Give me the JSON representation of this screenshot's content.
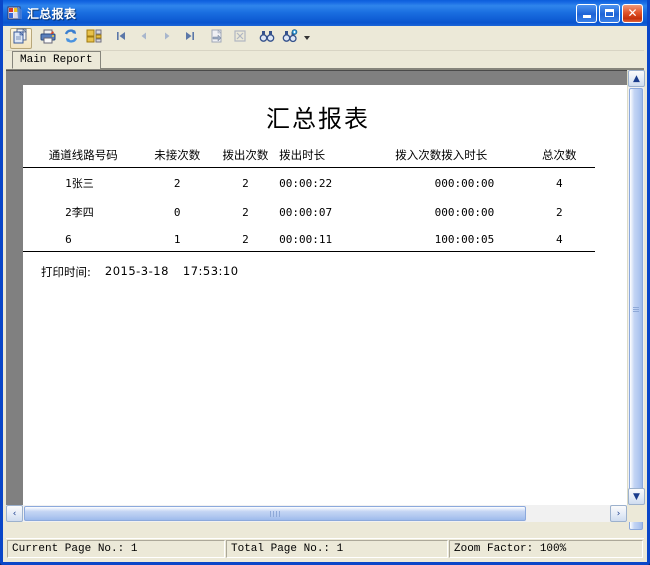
{
  "window": {
    "title": "汇总报表",
    "icon": "report-window-icon",
    "controls": {
      "minimize": "minimize-button",
      "maximize": "maximize-button",
      "close": "close-button"
    }
  },
  "toolbar": {
    "buttons": [
      {
        "name": "export-report-icon",
        "label": "Export",
        "state": "selected"
      },
      {
        "name": "print-icon",
        "label": "Print",
        "state": "enabled"
      },
      {
        "name": "refresh-icon",
        "label": "Refresh",
        "state": "enabled"
      },
      {
        "name": "toggle-group-tree-icon",
        "label": "Toggle Group Tree",
        "state": "enabled"
      },
      {
        "name": "first-page-icon",
        "label": "First Page",
        "state": "enabled"
      },
      {
        "name": "previous-page-icon",
        "label": "Previous Page",
        "state": "disabled"
      },
      {
        "name": "next-page-icon",
        "label": "Next Page",
        "state": "disabled"
      },
      {
        "name": "last-page-icon",
        "label": "Last Page",
        "state": "enabled"
      },
      {
        "name": "go-to-page-icon",
        "label": "Go To Page",
        "state": "disabled"
      },
      {
        "name": "stop-icon",
        "label": "Stop",
        "state": "disabled"
      },
      {
        "name": "search-icon",
        "label": "Search Text",
        "state": "enabled"
      },
      {
        "name": "zoom-search-icon",
        "label": "Zoom",
        "state": "enabled"
      }
    ],
    "dropdown_arrow": "chevron-down-icon"
  },
  "tabs": {
    "items": [
      {
        "label": "Main Report",
        "active": true
      }
    ]
  },
  "report": {
    "title": "汇总报表",
    "columns": [
      "通道",
      "线路号码",
      "未接次数",
      "拨出次数",
      "拨出时长",
      "拨入次数",
      "拨入时长",
      "总次数"
    ],
    "rows": [
      {
        "channel": "1",
        "line_number": "张三",
        "missed_count": "2",
        "outgoing_count": "2",
        "outgoing_duration": "00:00:22",
        "incoming_count": "0",
        "incoming_duration": "00:00:00",
        "total_count": "4"
      },
      {
        "channel": "2",
        "line_number": "李四",
        "missed_count": "0",
        "outgoing_count": "2",
        "outgoing_duration": "00:00:07",
        "incoming_count": "0",
        "incoming_duration": "00:00:00",
        "total_count": "2"
      },
      {
        "channel": "6",
        "line_number": "",
        "missed_count": "1",
        "outgoing_count": "2",
        "outgoing_duration": "00:00:11",
        "incoming_count": "1",
        "incoming_duration": "00:00:05",
        "total_count": "4"
      }
    ],
    "print_label": "打印时间:",
    "print_date": "2015-3-18",
    "print_time": "17:53:10"
  },
  "scrollbars": {
    "vertical": {
      "up": "▲",
      "down": "▼"
    },
    "horizontal": {
      "left": "‹",
      "right": "›"
    }
  },
  "statusbar": {
    "current_page": "Current Page No.: 1",
    "total_page": "Total Page No.: 1",
    "zoom_factor": "Zoom Factor: 100%"
  },
  "colors": {
    "title_bar": "#1668e3",
    "client_bg": "#ece9d8",
    "page_bg": "#ffffff",
    "viewer_bg": "#808080",
    "scroll_thumb": "#b2c8f0"
  }
}
